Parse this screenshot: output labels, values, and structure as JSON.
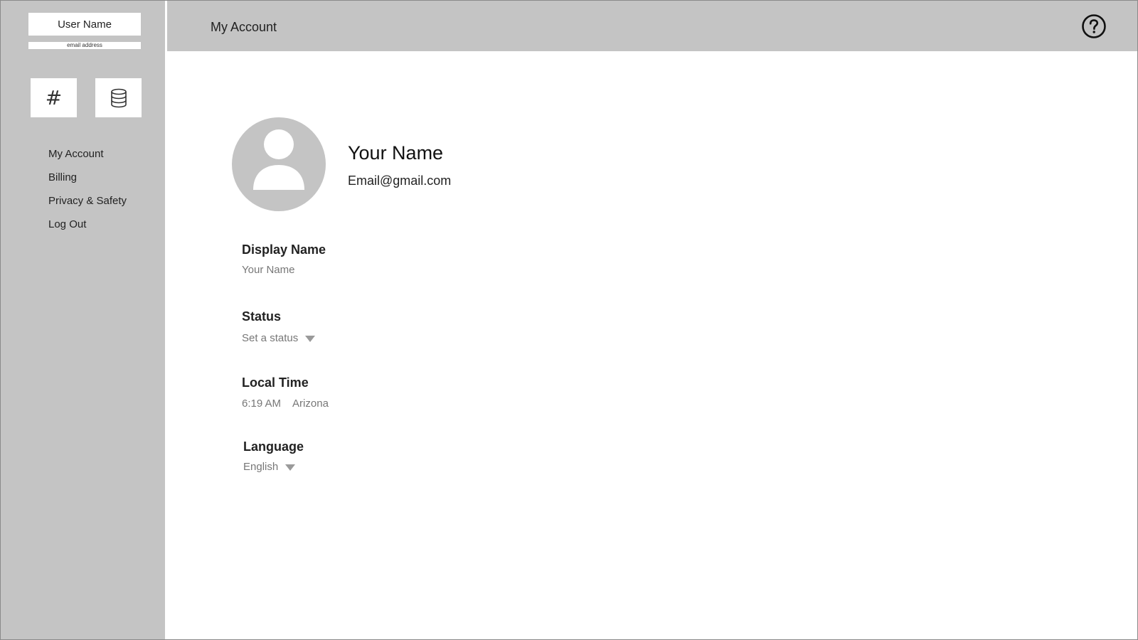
{
  "sidebar": {
    "user_name": "User Name",
    "email_address": "email address",
    "icons": [
      {
        "name": "hash-icon",
        "glyph": "#"
      },
      {
        "name": "database-icon"
      }
    ],
    "items": [
      {
        "label": "My Account"
      },
      {
        "label": "Billing"
      },
      {
        "label": "Privacy & Safety"
      },
      {
        "label": "Log Out"
      }
    ]
  },
  "header": {
    "title": "My Account",
    "help_icon": "help-circle-icon"
  },
  "profile": {
    "name": "Your Name",
    "email": "Email@gmail.com",
    "avatar_icon": "user-avatar-icon"
  },
  "fields": {
    "display_name": {
      "label": "Display Name",
      "value": "Your Name"
    },
    "status": {
      "label": "Status",
      "value": "Set a status"
    },
    "local_time": {
      "label": "Local Time",
      "time": "6:19 AM",
      "zone": "Arizona"
    },
    "language": {
      "label": "Language",
      "value": "English"
    }
  },
  "colors": {
    "sidebar_bg": "#c4c4c4",
    "header_bg": "#c4c4c4",
    "avatar_bg": "#c4c4c4",
    "page_bg": "#ffffff"
  }
}
